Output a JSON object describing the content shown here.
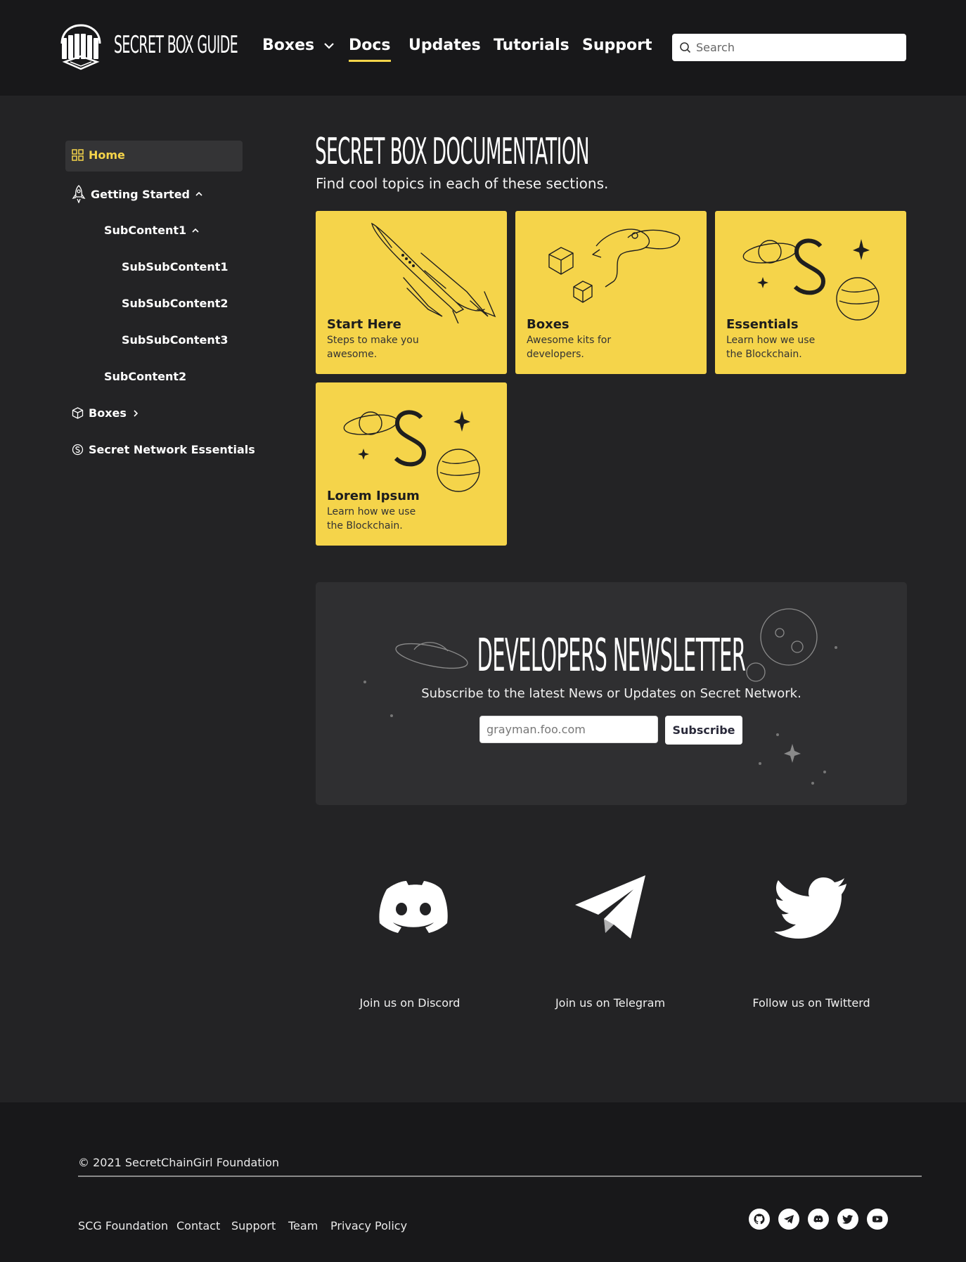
{
  "header": {
    "logo_text": "SECRET BOX GUIDE",
    "nav": [
      {
        "label": "Boxes"
      },
      {
        "label": "Docs"
      },
      {
        "label": "Updates"
      },
      {
        "label": "Tutorials"
      },
      {
        "label": "Support"
      }
    ],
    "search_placeholder": "Search"
  },
  "sidebar": {
    "home": "Home",
    "getting_started": "Getting Started",
    "subcontent1": "SubContent1",
    "subsub1": "SubSubContent1",
    "subsub2": "SubSubContent2",
    "subsub3": "SubSubContent3",
    "subcontent2": "SubContent2",
    "boxes": "Boxes",
    "secret_essentials": "Secret Network Essentials"
  },
  "main": {
    "title": "SECRET BOX DOCUMENTATION",
    "subtitle": "Find cool topics in each of these sections.",
    "cards": [
      {
        "title": "Start Here",
        "desc": "Steps to make you awesome."
      },
      {
        "title": "Boxes",
        "desc": "Awesome kits for developers."
      },
      {
        "title": "Essentials",
        "desc": "Learn how we use the Blockchain."
      },
      {
        "title": "Lorem Ipsum",
        "desc": "Learn how we use the Blockchain."
      }
    ]
  },
  "newsletter": {
    "title": "DEVELOPERS NEWSLETTER",
    "subtitle": "Subscribe to the latest News or Updates on Secret Network.",
    "input_placeholder": "grayman.foo.com",
    "button": "Subscribe"
  },
  "social": [
    {
      "label": "Join us on Discord",
      "icon": "discord-icon"
    },
    {
      "label": "Join us on Telegram",
      "icon": "telegram-icon"
    },
    {
      "label": "Follow us on Twitterd",
      "icon": "twitter-icon"
    }
  ],
  "footer": {
    "copyright": "© 2021 SecretChainGirl Foundation",
    "links": [
      "SCG Foundation",
      "Contact",
      "Support",
      "Team",
      "Privacy Policy"
    ],
    "icons": [
      "github-icon",
      "telegram-icon",
      "discord-icon",
      "twitter-icon",
      "youtube-icon"
    ]
  },
  "colors": {
    "accent": "#f5d44a",
    "background": "#232325",
    "header": "#18181a"
  }
}
